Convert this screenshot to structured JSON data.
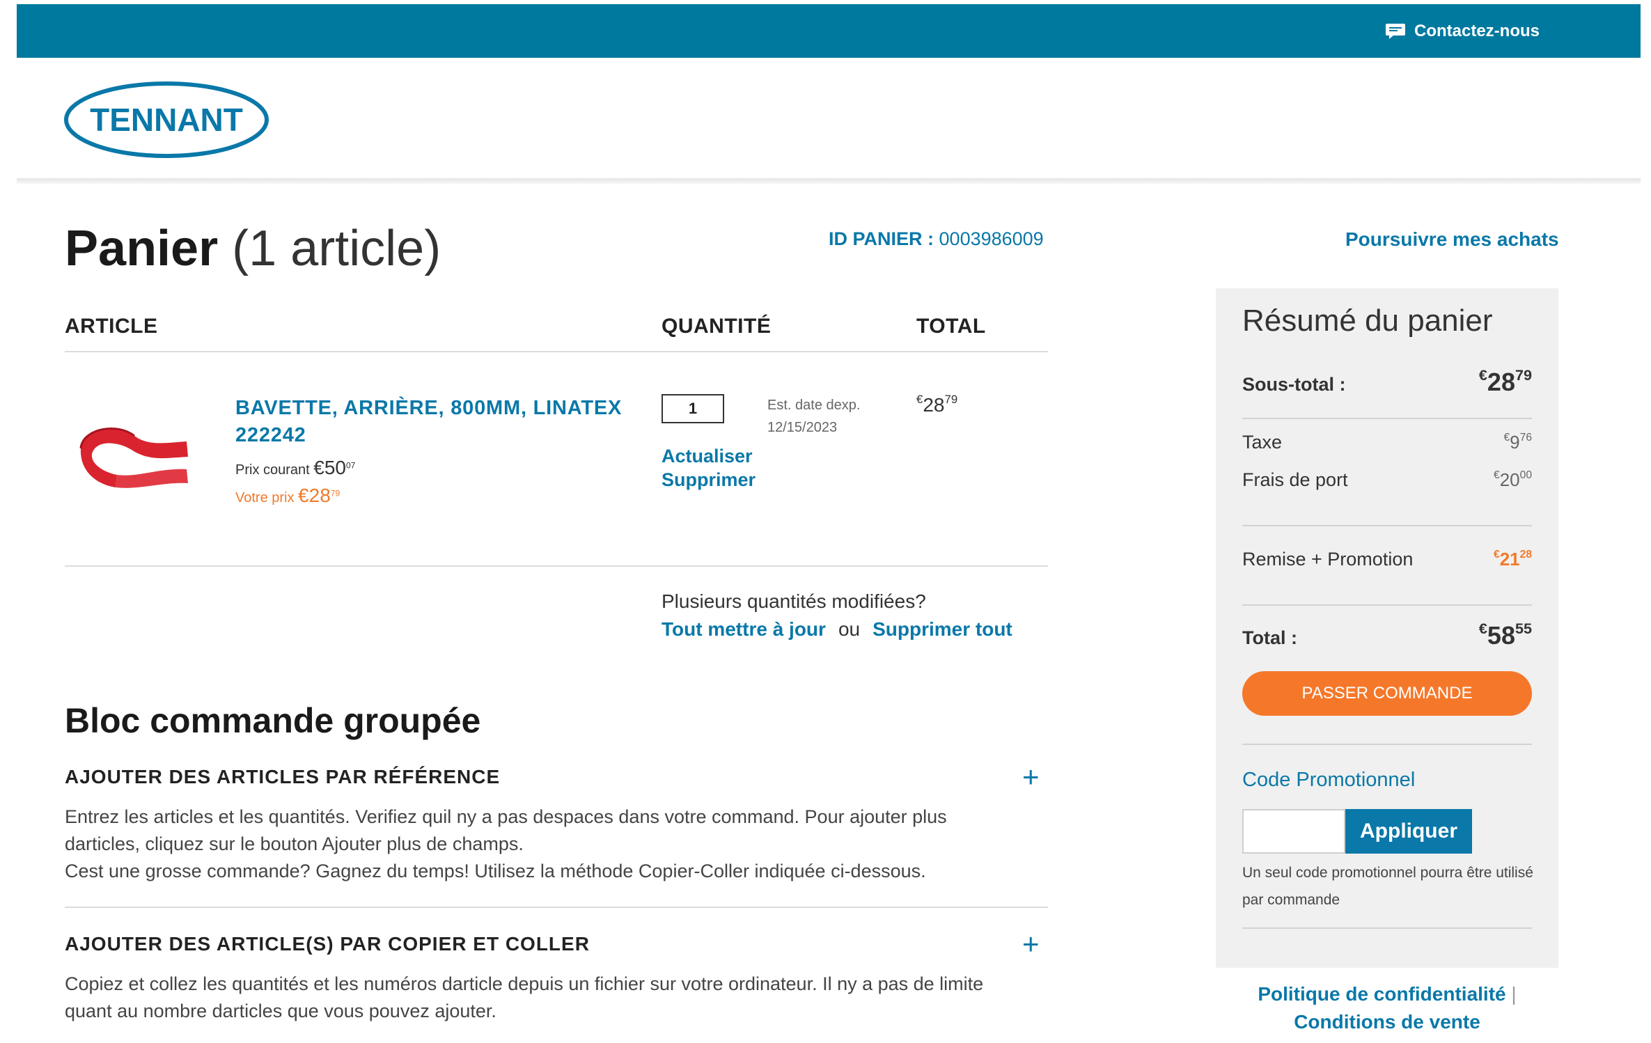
{
  "header": {
    "contact_label": "Contactez-nous",
    "logo_text": "TENNANT"
  },
  "cart": {
    "title": "Panier",
    "count_label": "(1 article)",
    "id_label": "ID PANIER :",
    "id_value": "0003986009",
    "continue_label": "Poursuivre mes achats",
    "columns": {
      "article": "ARTICLE",
      "quantity": "QUANTITÉ",
      "total": "TOTAL"
    },
    "item": {
      "name": "BAVETTE, ARRIÈRE, 800MM, LINATEX",
      "part_number": "222242",
      "list_price_label": "Prix courant",
      "list_price_main": "€50",
      "list_price_cents": "07",
      "your_price_label": "Votre prix",
      "your_price_main": "€28",
      "your_price_cents": "79",
      "quantity": "1",
      "update_label": "Actualiser",
      "remove_label": "Supprimer",
      "est_label": "Est. date dexp.",
      "est_date": "12/15/2023",
      "total_currency": "€",
      "total_main": "28",
      "total_cents": "79"
    },
    "multi": {
      "question": "Plusieurs quantités modifiées?",
      "update_all": "Tout mettre à jour",
      "or": "ou",
      "remove_all": "Supprimer tout"
    }
  },
  "bulk": {
    "title": "Bloc commande groupée",
    "sections": [
      {
        "title": "AJOUTER DES ARTICLES PAR RÉFÉRENCE",
        "expand": "+",
        "line1": "Entrez les articles et les quantités. Verifiez quil ny a pas despaces dans votre command. Pour ajouter plus darticles, cliquez sur le bouton Ajouter plus de champs.",
        "line2": "Cest une grosse commande? Gagnez du temps! Utilisez la méthode Copier-Coller indiquée ci-dessous."
      },
      {
        "title": "AJOUTER DES ARTICLE(S) PAR COPIER ET COLLER",
        "expand": "+",
        "line1": "Copiez et collez les quantités et les numéros darticle depuis un fichier sur votre ordinateur. Il ny a pas de limite quant au nombre darticles que vous pouvez ajouter."
      }
    ]
  },
  "summary": {
    "title": "Résumé du panier",
    "subtotal_label": "Sous-total :",
    "subtotal_cur": "€",
    "subtotal_main": "28",
    "subtotal_cents": "79",
    "tax_label": "Taxe",
    "tax_cur": "€",
    "tax_main": "9",
    "tax_cents": "76",
    "shipping_label": "Frais de port",
    "shipping_cur": "€",
    "shipping_main": "20",
    "shipping_cents": "00",
    "discount_label": "Remise + Promotion",
    "discount_cur": "€",
    "discount_main": "21",
    "discount_cents": "28",
    "total_label": "Total :",
    "total_cur": "€",
    "total_main": "58",
    "total_cents": "55",
    "checkout_label": "PASSER COMMANDE",
    "promo_label": "Code Promotionnel",
    "promo_button": "Appliquer",
    "promo_help": "Un seul code promotionnel pourra être utilisé par commande",
    "colors": {
      "checkout": "#f5782a",
      "accent": "#0a78a8",
      "discount": "#f07a2a"
    }
  },
  "footer": {
    "privacy": "Politique de confidentialité",
    "separator": "|",
    "terms": "Conditions de vente"
  }
}
